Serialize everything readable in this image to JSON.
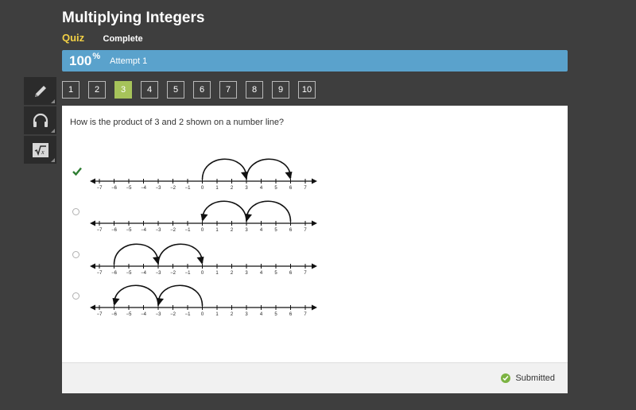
{
  "header": {
    "title": "Multiplying Integers",
    "quiz_label": "Quiz",
    "status": "Complete"
  },
  "score": {
    "value": "100",
    "unit": "%",
    "attempt": "Attempt 1"
  },
  "tools": [
    {
      "icon": "pencil-icon"
    },
    {
      "icon": "headphones-icon"
    },
    {
      "icon": "calculator-icon"
    }
  ],
  "question_nav": [
    "1",
    "2",
    "3",
    "4",
    "5",
    "6",
    "7",
    "8",
    "9",
    "10"
  ],
  "current_question": "3",
  "question": {
    "text": "How is the product of 3 and 2 shown on a number line?"
  },
  "tick_labels": [
    "−7",
    "−6",
    "−5",
    "−4",
    "−3",
    "−2",
    "−1",
    "0",
    "1",
    "2",
    "3",
    "4",
    "5",
    "6",
    "7"
  ],
  "options": [
    {
      "selected": true,
      "arrows": [
        [
          0,
          3
        ],
        [
          3,
          6
        ]
      ]
    },
    {
      "selected": false,
      "arrows": [
        [
          6,
          3
        ],
        [
          3,
          0
        ]
      ]
    },
    {
      "selected": false,
      "arrows": [
        [
          -6,
          -3
        ],
        [
          -3,
          0
        ]
      ]
    },
    {
      "selected": false,
      "arrows": [
        [
          0,
          -3
        ],
        [
          -3,
          -6
        ]
      ]
    }
  ],
  "footer": {
    "status": "Submitted"
  },
  "colors": {
    "accent_blue": "#5aa2cc",
    "active_green": "#a6c35a",
    "quiz_yellow": "#f2d045",
    "check_green": "#2e7d32"
  }
}
